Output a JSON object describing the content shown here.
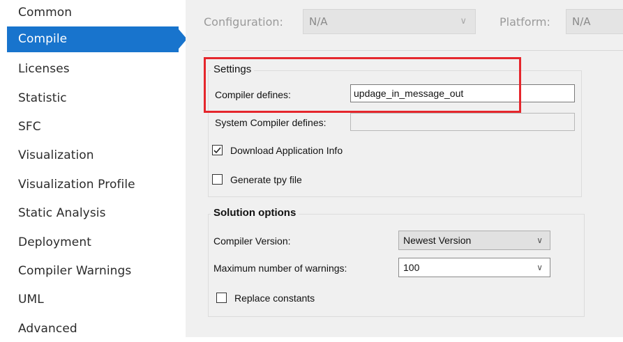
{
  "sidebar": {
    "items": [
      {
        "label": "Common"
      },
      {
        "label": "Compile"
      },
      {
        "label": "Licenses"
      },
      {
        "label": "Statistic"
      },
      {
        "label": "SFC"
      },
      {
        "label": "Visualization"
      },
      {
        "label": "Visualization Profile"
      },
      {
        "label": "Static Analysis"
      },
      {
        "label": "Deployment"
      },
      {
        "label": "Compiler Warnings"
      },
      {
        "label": "UML"
      },
      {
        "label": "Advanced"
      }
    ],
    "active_item": "Compile"
  },
  "toolbar": {
    "configuration_label": "Configuration:",
    "configuration_value": "N/A",
    "platform_label": "Platform:",
    "platform_value": "N/A"
  },
  "settings": {
    "title": "Settings",
    "compiler_defines_label": "Compiler defines:",
    "compiler_defines_value": "updage_in_message_out",
    "system_compiler_defines_label": "System Compiler defines:",
    "system_compiler_defines_value": "",
    "download_app_info_label": "Download Application Info",
    "download_app_info_checked": true,
    "generate_tpy_label": "Generate tpy file",
    "generate_tpy_checked": false
  },
  "solution_options": {
    "title": "Solution options",
    "compiler_version_label": "Compiler Version:",
    "compiler_version_value": "Newest Version",
    "max_warnings_label": "Maximum number of warnings:",
    "max_warnings_value": "100",
    "replace_constants_label": "Replace constants",
    "replace_constants_checked": false
  },
  "colors": {
    "accent": "#1874cd",
    "highlight": "#e5262c",
    "panel_bg": "#f0f0f0"
  },
  "icons": {
    "dropdown": "chevron-down-icon",
    "checkbox_checked": "checkmark-icon",
    "active_indicator": "arrow-right-icon"
  }
}
